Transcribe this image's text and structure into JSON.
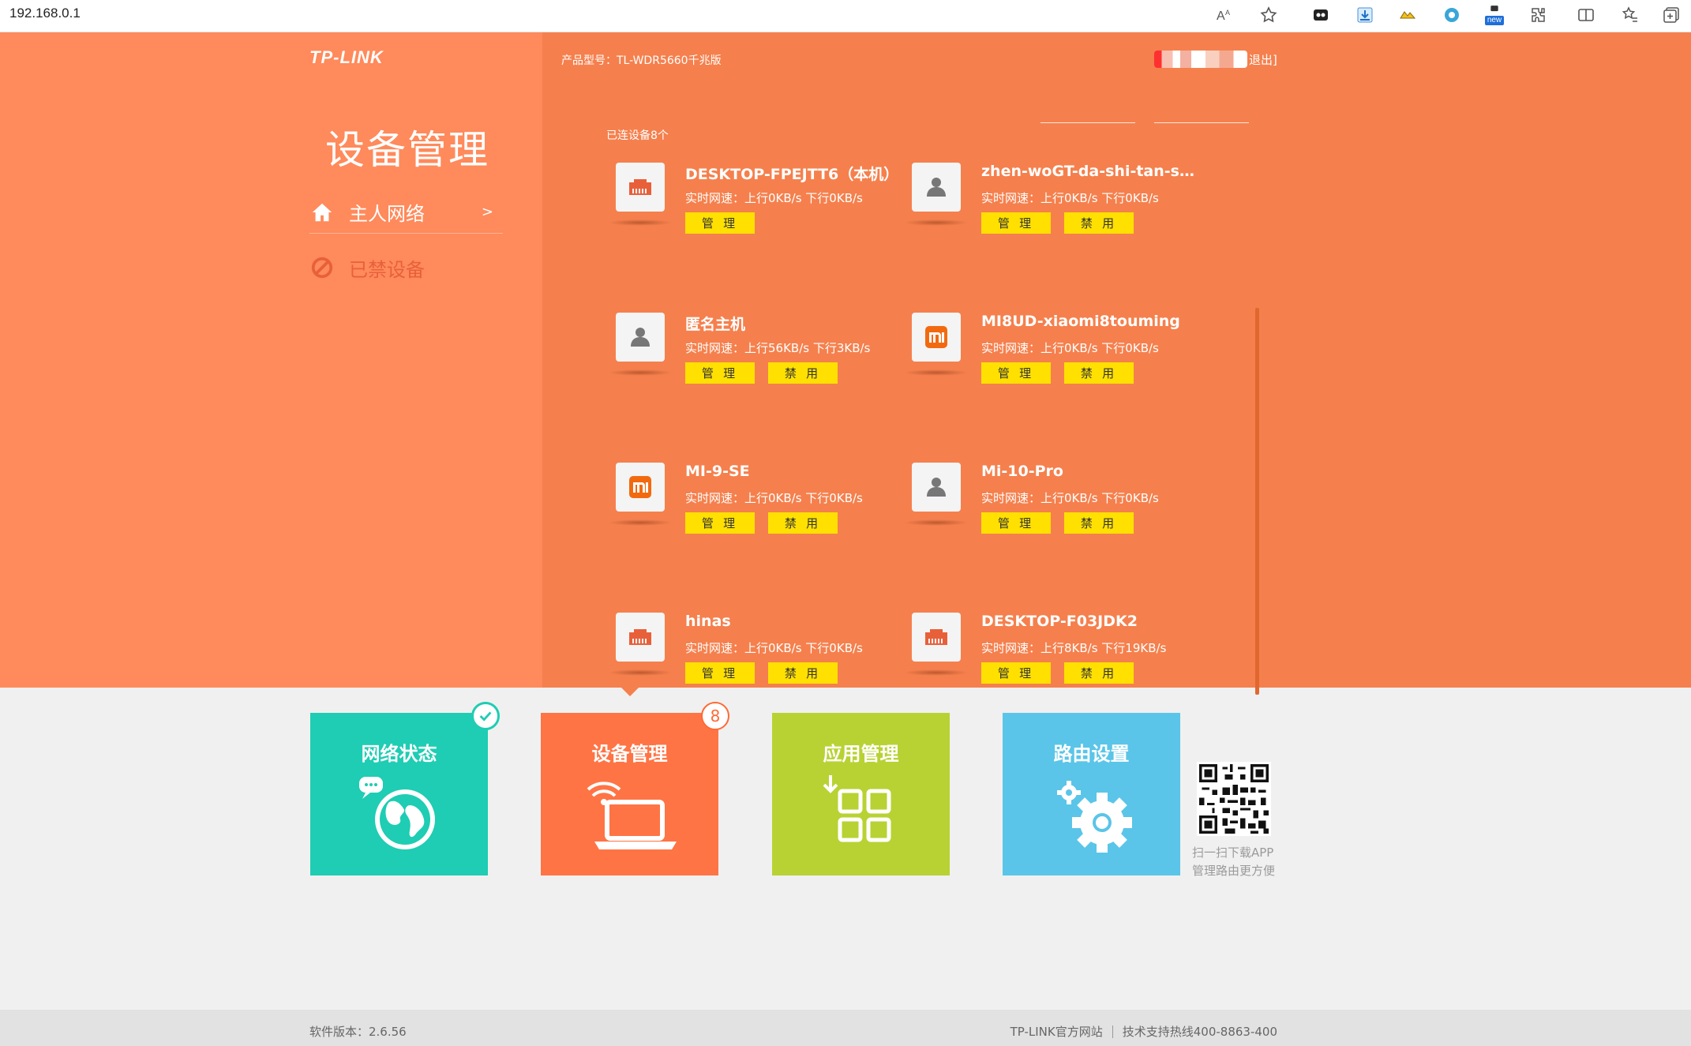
{
  "browser": {
    "url": "192.168.0.1",
    "new_badge": "new"
  },
  "header": {
    "brand": "TP-LINK",
    "model_label": "产品型号：TL-WDR5660千兆版",
    "logout": "退出]"
  },
  "sidebar": {
    "title": "设备管理",
    "items": [
      {
        "label": "主人网络",
        "arrow": ">"
      },
      {
        "label": "已禁设备"
      }
    ]
  },
  "devices": {
    "count_label": "已连设备8个",
    "manage_label": "管 理",
    "ban_label": "禁 用",
    "list": [
      {
        "name": "DESKTOP-FPEJTT6（本机）",
        "speed": "实时网速：上行0KB/s 下行0KB/s",
        "icon": "ethernet-icon"
      },
      {
        "name": "zhen-woGT-da-shi-tan-su...",
        "speed": "实时网速：上行0KB/s 下行0KB/s",
        "icon": "person-icon"
      },
      {
        "name": "匿名主机",
        "speed": "实时网速：上行56KB/s 下行3KB/s",
        "icon": "person-icon"
      },
      {
        "name": "MI8UD-xiaomi8touming",
        "speed": "实时网速：上行0KB/s 下行0KB/s",
        "icon": "mi-logo-icon"
      },
      {
        "name": "MI-9-SE",
        "speed": "实时网速：上行0KB/s 下行0KB/s",
        "icon": "mi-logo-icon"
      },
      {
        "name": "Mi-10-Pro",
        "speed": "实时网速：上行0KB/s 下行0KB/s",
        "icon": "person-icon"
      },
      {
        "name": "hinas",
        "speed": "实时网速：上行0KB/s 下行0KB/s",
        "icon": "ethernet-icon"
      },
      {
        "name": "DESKTOP-F03JDK2",
        "speed": "实时网速：上行8KB/s 下行19KB/s",
        "icon": "ethernet-icon"
      }
    ]
  },
  "tiles": {
    "network": "网络状态",
    "devices": "设备管理",
    "devices_badge": "8",
    "apps": "应用管理",
    "router": "路由设置"
  },
  "qr": {
    "line1": "扫一扫下载APP",
    "line2": "管理路由更方便"
  },
  "footer": {
    "version": "软件版本：2.6.56",
    "site": "TP-LINK官方网站",
    "hotline": "技术支持热线400-8863-400"
  },
  "colors": {
    "hero": "#f5804d",
    "sidebar": "#ff8a5b",
    "button": "#ffe000",
    "tile_network": "#1ecdb3",
    "tile_devices": "#ff7445",
    "tile_apps": "#b8d233",
    "tile_router": "#5ac5e8"
  }
}
